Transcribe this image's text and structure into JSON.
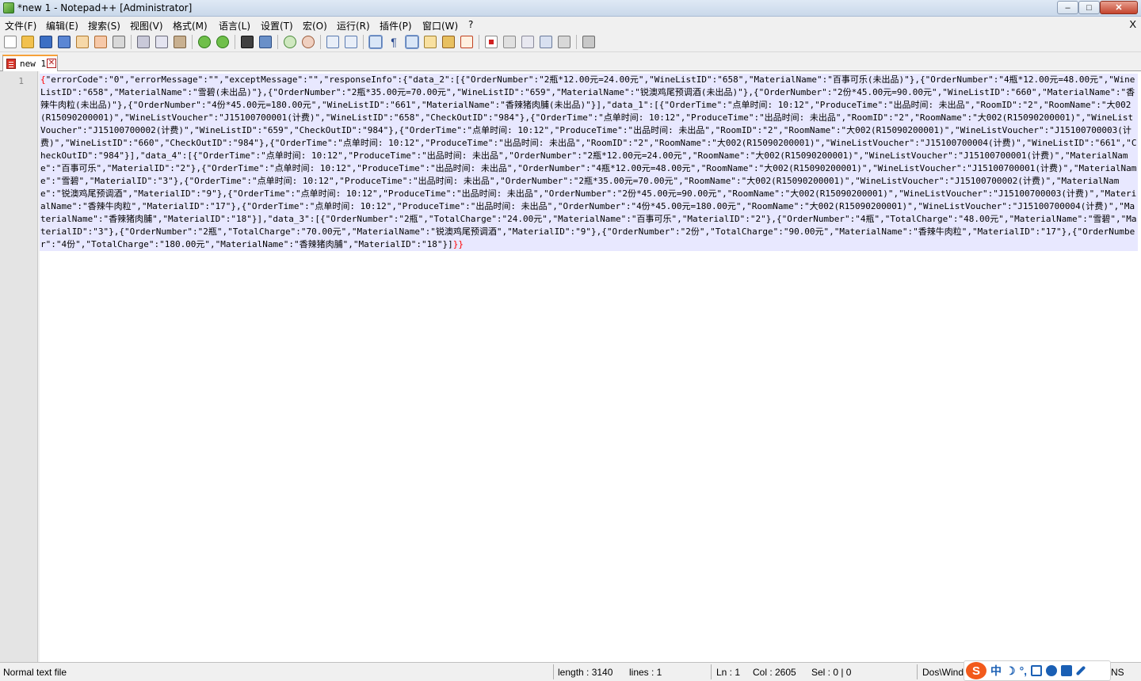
{
  "window": {
    "title": "*new 1 - Notepad++ [Administrator]",
    "minimize": "–",
    "maximize": "□",
    "close": "✕"
  },
  "menu": {
    "items": [
      "文件(F)",
      "编辑(E)",
      "搜索(S)",
      "视图(V)",
      "格式(M)",
      "语言(L)",
      "设置(T)",
      "宏(O)",
      "运行(R)",
      "插件(P)",
      "窗口(W)",
      "?"
    ],
    "doc_close": "X"
  },
  "toolbar": {
    "icons": [
      "new-file-icon",
      "open-file-icon",
      "save-icon",
      "save-all-icon",
      "close-icon",
      "close-all-icon",
      "print-icon",
      "cut-icon",
      "copy-icon",
      "paste-icon",
      "undo-icon",
      "redo-icon",
      "find-icon",
      "replace-icon",
      "zoom-in-icon",
      "zoom-out-icon",
      "sync-vertical-icon",
      "sync-horizontal-icon",
      "word-wrap-icon",
      "show-all-chars-icon",
      "indent-guide-icon",
      "document-map-icon",
      "function-list-icon",
      "folder-workspace-icon",
      "record-macro-icon",
      "stop-macro-icon",
      "play-macro-icon",
      "run-macro-multiple-icon",
      "save-macro-icon",
      "launch-browser-icon"
    ]
  },
  "tab": {
    "label": "new 1",
    "close": "✕"
  },
  "editor": {
    "line_number": "1",
    "open_brace": "{",
    "content": "\"errorCode\":\"0\",\"errorMessage\":\"\",\"exceptMessage\":\"\",\"responseInfo\":{\"data_2\":[{\"OrderNumber\":\"2瓶*12.00元=24.00元\",\"WineListID\":\"658\",\"MaterialName\":\"百事可乐(未出品)\"},{\"OrderNumber\":\"4瓶*12.00元=48.00元\",\"WineListID\":\"658\",\"MaterialName\":\"雪碧(未出品)\"},{\"OrderNumber\":\"2瓶*35.00元=70.00元\",\"WineListID\":\"659\",\"MaterialName\":\"锐澳鸡尾预调酒(未出品)\"},{\"OrderNumber\":\"2份*45.00元=90.00元\",\"WineListID\":\"660\",\"MaterialName\":\"香辣牛肉粒(未出品)\"},{\"OrderNumber\":\"4份*45.00元=180.00元\",\"WineListID\":\"661\",\"MaterialName\":\"香辣猪肉脯(未出品)\"}],\"data_1\":[{\"OrderTime\":\"点单时间: 10:12\",\"ProduceTime\":\"出品时间: 未出品\",\"RoomID\":\"2\",\"RoomName\":\"大002(R15090200001)\",\"WineListVoucher\":\"J15100700001(计费)\",\"WineListID\":\"658\",\"CheckOutID\":\"984\"},{\"OrderTime\":\"点单时间: 10:12\",\"ProduceTime\":\"出品时间: 未出品\",\"RoomID\":\"2\",\"RoomName\":\"大002(R15090200001)\",\"WineListVoucher\":\"J15100700002(计费)\",\"WineListID\":\"659\",\"CheckOutID\":\"984\"},{\"OrderTime\":\"点单时间: 10:12\",\"ProduceTime\":\"出品时间: 未出品\",\"RoomID\":\"2\",\"RoomName\":\"大002(R15090200001)\",\"WineListVoucher\":\"J15100700003(计费)\",\"WineListID\":\"660\",\"CheckOutID\":\"984\"},{\"OrderTime\":\"点单时间: 10:12\",\"ProduceTime\":\"出品时间: 未出品\",\"RoomID\":\"2\",\"RoomName\":\"大002(R15090200001)\",\"WineListVoucher\":\"J15100700004(计费)\",\"WineListID\":\"661\",\"CheckOutID\":\"984\"}],\"data_4\":[{\"OrderTime\":\"点单时间: 10:12\",\"ProduceTime\":\"出品时间: 未出品\",\"OrderNumber\":\"2瓶*12.00元=24.00元\",\"RoomName\":\"大002(R15090200001)\",\"WineListVoucher\":\"J15100700001(计费)\",\"MaterialName\":\"百事可乐\",\"MaterialID\":\"2\"},{\"OrderTime\":\"点单时间: 10:12\",\"ProduceTime\":\"出品时间: 未出品\",\"OrderNumber\":\"4瓶*12.00元=48.00元\",\"RoomName\":\"大002(R15090200001)\",\"WineListVoucher\":\"J15100700001(计费)\",\"MaterialName\":\"雪碧\",\"MaterialID\":\"3\"},{\"OrderTime\":\"点单时间: 10:12\",\"ProduceTime\":\"出品时间: 未出品\",\"OrderNumber\":\"2瓶*35.00元=70.00元\",\"RoomName\":\"大002(R15090200001)\",\"WineListVoucher\":\"J15100700002(计费)\",\"MaterialName\":\"锐澳鸡尾预调酒\",\"MaterialID\":\"9\"},{\"OrderTime\":\"点单时间: 10:12\",\"ProduceTime\":\"出品时间: 未出品\",\"OrderNumber\":\"2份*45.00元=90.00元\",\"RoomName\":\"大002(R15090200001)\",\"WineListVoucher\":\"J15100700003(计费)\",\"MaterialName\":\"香辣牛肉粒\",\"MaterialID\":\"17\"},{\"OrderTime\":\"点单时间: 10:12\",\"ProduceTime\":\"出品时间: 未出品\",\"OrderNumber\":\"4份*45.00元=180.00元\",\"RoomName\":\"大002(R15090200001)\",\"WineListVoucher\":\"J15100700004(计费)\",\"MaterialName\":\"香辣猪肉脯\",\"MaterialID\":\"18\"}],\"data_3\":[{\"OrderNumber\":\"2瓶\",\"TotalCharge\":\"24.00元\",\"MaterialName\":\"百事可乐\",\"MaterialID\":\"2\"},{\"OrderNumber\":\"4瓶\",\"TotalCharge\":\"48.00元\",\"MaterialName\":\"雪碧\",\"MaterialID\":\"3\"},{\"OrderNumber\":\"2瓶\",\"TotalCharge\":\"70.00元\",\"MaterialName\":\"锐澳鸡尾预调酒\",\"MaterialID\":\"9\"},{\"OrderNumber\":\"2份\",\"TotalCharge\":\"90.00元\",\"MaterialName\":\"香辣牛肉粒\",\"MaterialID\":\"17\"},{\"OrderNumber\":\"4份\",\"TotalCharge\":\"180.00元\",\"MaterialName\":\"香辣猪肉脯\",\"MaterialID\":\"18\"}]",
    "close_braces": "}}"
  },
  "status": {
    "file_type": "Normal text file",
    "length": "length : 3140",
    "lines": "lines : 1",
    "ln": "Ln : 1",
    "col": "Col : 2605",
    "sel": "Sel : 0 | 0",
    "eol": "Dos\\Windows",
    "encoding_tail": "NS"
  },
  "ime": {
    "logo": "S",
    "mode": "中"
  },
  "colors": {
    "selection_bg": "#e8e8ff",
    "brace_red": "#ff0000",
    "tab_accent": "#f7a13a"
  }
}
